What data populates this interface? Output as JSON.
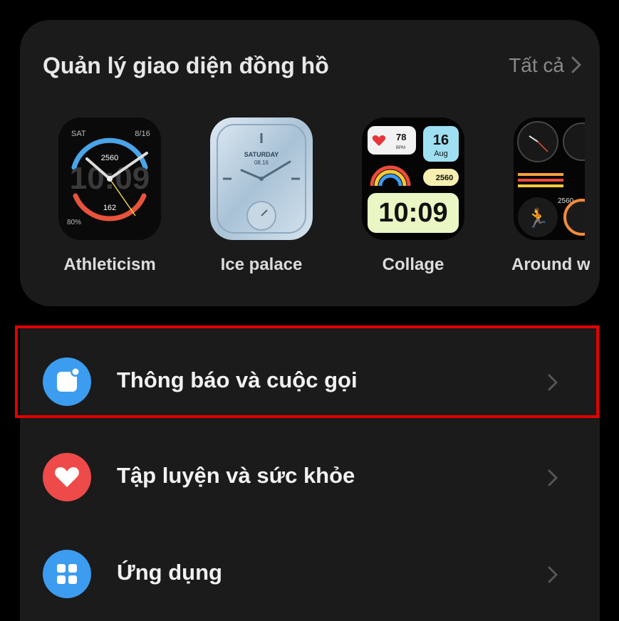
{
  "watchfaces": {
    "title": "Quản lý giao diện đồng hồ",
    "see_all": "Tất cả",
    "items": [
      {
        "label": "Athleticism",
        "day": "SAT",
        "date": "8/16",
        "steps": "2560",
        "time_bg": "10:09",
        "calories": "162",
        "battery": "80%"
      },
      {
        "label": "Ice palace",
        "day": "SATURDAY",
        "date": "08.16"
      },
      {
        "label": "Collage",
        "heart": "78",
        "heart_unit": "BPM",
        "day_num": "16",
        "month": "Aug",
        "steps": "2560",
        "time": "10:09"
      },
      {
        "label": "Around w",
        "steps": "2560"
      }
    ]
  },
  "menu": {
    "items": [
      {
        "label": "Thông báo và cuộc gọi",
        "icon_color": "#3b9cf0"
      },
      {
        "label": "Tập luyện và sức khỏe",
        "icon_color": "#ef4a4a"
      },
      {
        "label": "Ứng dụng",
        "icon_color": "#3b9cf0"
      }
    ]
  },
  "colors": {
    "highlight": "#e30000",
    "card_bg": "#1b1b1b"
  }
}
